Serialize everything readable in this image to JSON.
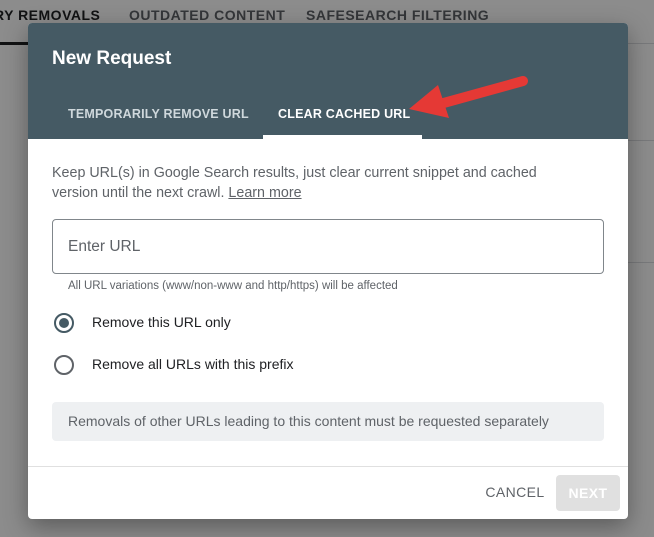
{
  "background": {
    "tabs": [
      {
        "label": "RY REMOVALS",
        "active": true
      },
      {
        "label": "OUTDATED CONTENT",
        "active": false
      },
      {
        "label": "SAFESEARCH FILTERING",
        "active": false
      }
    ]
  },
  "dialog": {
    "title": "New Request",
    "tabs": [
      {
        "label": "TEMPORARILY REMOVE URL",
        "active": false
      },
      {
        "label": "CLEAR CACHED URL",
        "active": true
      }
    ],
    "description": "Keep URL(s) in Google Search results, just clear current snippet and cached version until the next crawl.",
    "learn_more": "Learn more",
    "url_field": {
      "value": "",
      "placeholder": "Enter URL",
      "helper": "All URL variations (www/non-www and http/https) will be affected"
    },
    "options": [
      {
        "label": "Remove this URL only",
        "selected": true
      },
      {
        "label": "Remove all URLs with this prefix",
        "selected": false
      }
    ],
    "info": "Removals of other URLs leading to this content must be requested separately",
    "actions": {
      "cancel": "CANCEL",
      "next": "NEXT",
      "next_enabled": false
    }
  },
  "colors": {
    "header": "#455a64",
    "annotation_arrow": "#e53935",
    "next_disabled_bg": "#e0e0e0"
  },
  "icons": {
    "annotation": "red-arrow-icon",
    "radio_selected": "radio-checked-icon",
    "radio_unselected": "radio-unchecked-icon"
  }
}
